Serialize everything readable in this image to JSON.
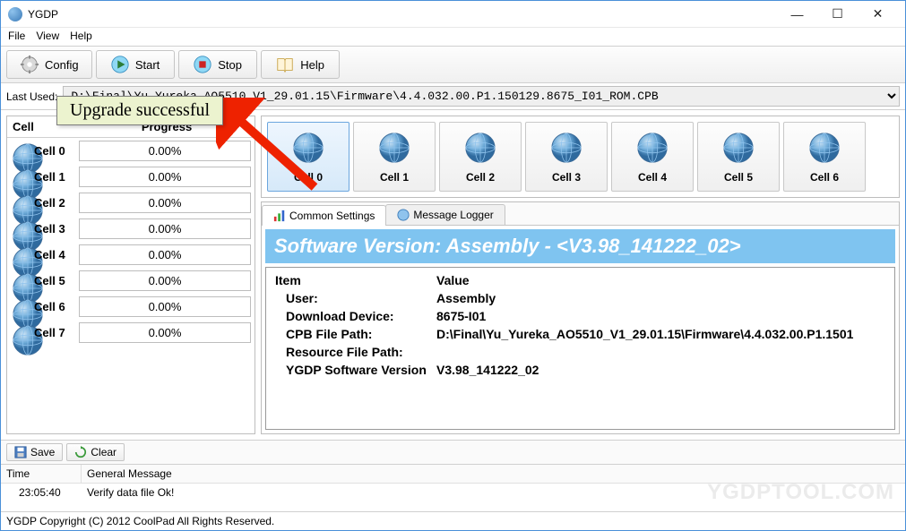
{
  "window": {
    "title": "YGDP"
  },
  "menu": {
    "file": "File",
    "view": "View",
    "help": "Help"
  },
  "toolbar": {
    "config": "Config",
    "start": "Start",
    "stop": "Stop",
    "help": "Help"
  },
  "lastused": {
    "label": "Last Used:",
    "path": "D:\\Final\\Yu_Yureka_AO5510_V1_29.01.15\\Firmware\\4.4.032.00.P1.150129.8675_I01_ROM.CPB"
  },
  "tooltip": "Upgrade successful",
  "left_panel": {
    "headers": {
      "cell": "Cell",
      "progress": "Progress"
    },
    "rows": [
      {
        "name": "Cell 0",
        "progress": "0.00%"
      },
      {
        "name": "Cell 1",
        "progress": "0.00%"
      },
      {
        "name": "Cell 2",
        "progress": "0.00%"
      },
      {
        "name": "Cell 3",
        "progress": "0.00%"
      },
      {
        "name": "Cell 4",
        "progress": "0.00%"
      },
      {
        "name": "Cell 5",
        "progress": "0.00%"
      },
      {
        "name": "Cell 6",
        "progress": "0.00%"
      },
      {
        "name": "Cell 7",
        "progress": "0.00%"
      }
    ]
  },
  "cell_strip": [
    "Cell 0",
    "Cell 1",
    "Cell 2",
    "Cell 3",
    "Cell 4",
    "Cell 5",
    "Cell 6"
  ],
  "tabs": {
    "common": "Common Settings",
    "logger": "Message Logger"
  },
  "banner": "Software Version:  Assembly - <V3.98_141222_02>",
  "settings": {
    "headers": {
      "item": "Item",
      "value": "Value"
    },
    "rows": [
      {
        "k": "User:",
        "v": "Assembly"
      },
      {
        "k": "Download Device:",
        "v": "8675-I01"
      },
      {
        "k": "CPB File Path:",
        "v": "D:\\Final\\Yu_Yureka_AO5510_V1_29.01.15\\Firmware\\4.4.032.00.P1.1501"
      },
      {
        "k": "Resource File Path:",
        "v": ""
      },
      {
        "k": "YGDP Software Version",
        "v": "V3.98_141222_02"
      }
    ]
  },
  "log_toolbar": {
    "save": "Save",
    "clear": "Clear"
  },
  "log": {
    "headers": {
      "time": "Time",
      "msg": "General Message"
    },
    "rows": [
      {
        "time": "23:05:40",
        "msg": "Verify data file Ok!"
      }
    ]
  },
  "statusbar": "YGDP Copyright (C) 2012 CoolPad All Rights Reserved.",
  "watermark": "YGDPTOOL.COM"
}
